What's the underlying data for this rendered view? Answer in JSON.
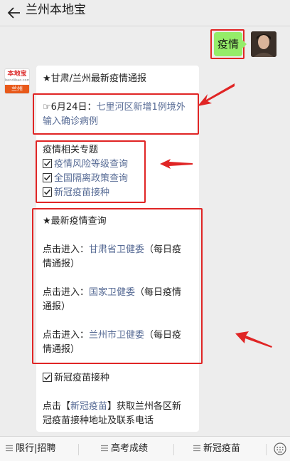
{
  "header": {
    "title": "兰州本地宝"
  },
  "user_message": {
    "text": "疫情"
  },
  "bot": {
    "logo_top": "本地宝",
    "logo_mid": "bendibao.com",
    "logo_city": "兰州"
  },
  "reply": {
    "heading": "★甘肃/兰州最新疫情通报",
    "news": {
      "prefix": "☞6月24日：",
      "link_line1": "七里河区新增1例境外",
      "link_line2": "输入确诊病例"
    },
    "topics": {
      "title": "疫情相关专题",
      "items": [
        "疫情风险等级查询",
        "全国隔离政策查询",
        "新冠疫苗接种"
      ]
    },
    "query": {
      "title": "★最新疫情查询",
      "entries": [
        {
          "prefix": "点击进入：",
          "link": "甘肃省卫健委",
          "suffix": "（每日疫",
          "line2": "情通报）"
        },
        {
          "prefix": "点击进入：",
          "link": "国家卫健委",
          "suffix": "（每日疫情",
          "line2": "通报）"
        },
        {
          "prefix": "点击进入：",
          "link": "兰州市卫健委",
          "suffix": "（每日疫",
          "line2": "情通报）"
        }
      ]
    },
    "vaccine": {
      "title": "新冠疫苗接种",
      "line1_prefix": "点击【",
      "line1_link": "新冠疫苗",
      "line1_suffix": "】获取兰州各区新",
      "line2": "冠疫苗接种地址及联系电话"
    }
  },
  "footer": {
    "tabs": [
      "限行|招聘",
      "高考成绩",
      "新冠疫苗"
    ]
  },
  "colors": {
    "accent_link": "#576b95",
    "highlight": "#e02525",
    "bubble_green": "#95ec69"
  }
}
